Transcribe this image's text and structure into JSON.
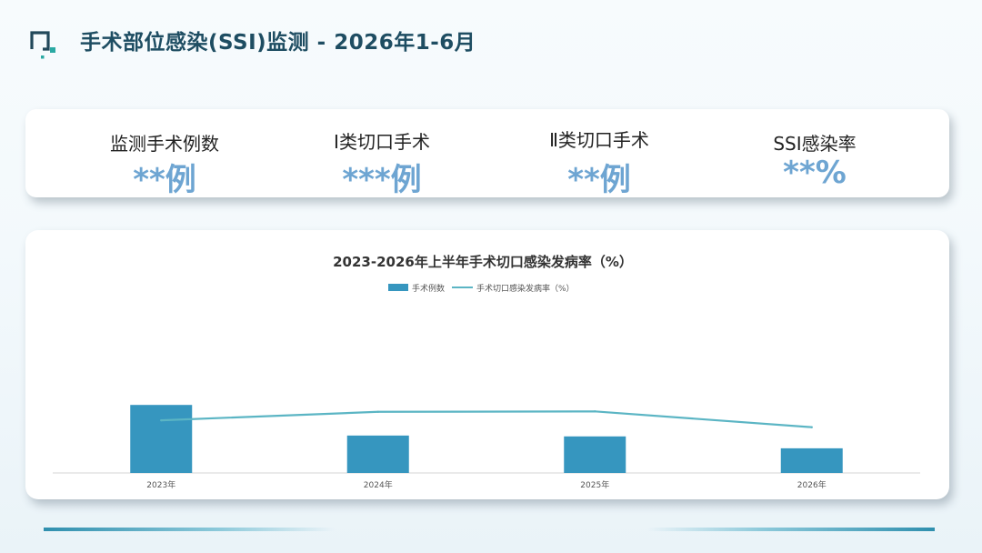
{
  "page": {
    "title": "手术部位感染(SSI)监测 - 2026年1-6月"
  },
  "colors": {
    "title": "#1e4d62",
    "accent": "#6ea5d2",
    "bar": "#3696bf",
    "line": "#5bb5c4",
    "logo_dark": "#21485a",
    "logo_teal": "#2aa9a3"
  },
  "icons": {
    "logo": "square-bracket-logo-icon"
  },
  "stats": [
    {
      "label": "监测手术例数",
      "value": "**例"
    },
    {
      "label": "Ⅰ类切口手术",
      "value": "***例"
    },
    {
      "label": "Ⅱ类切口手术",
      "value": "**例"
    },
    {
      "label": "SSI感染率",
      "value": "**%"
    }
  ],
  "chart_data": {
    "type": "bar",
    "title": "2023-2026年上半年手术切口感染发病率（%）",
    "categories": [
      "2023年",
      "2024年",
      "2025年",
      "2026年"
    ],
    "series": [
      {
        "name": "手术例数",
        "type": "bar",
        "values": [
          80,
          44,
          43,
          29
        ]
      },
      {
        "name": "手术切口感染发病率（%）",
        "type": "line",
        "values": [
          1.3,
          1.51,
          1.52,
          1.13
        ]
      }
    ],
    "bar_ylim": [
      0,
      200
    ],
    "line_ylim": [
      0,
      4.2
    ],
    "legend": "top-center",
    "grid": false
  }
}
